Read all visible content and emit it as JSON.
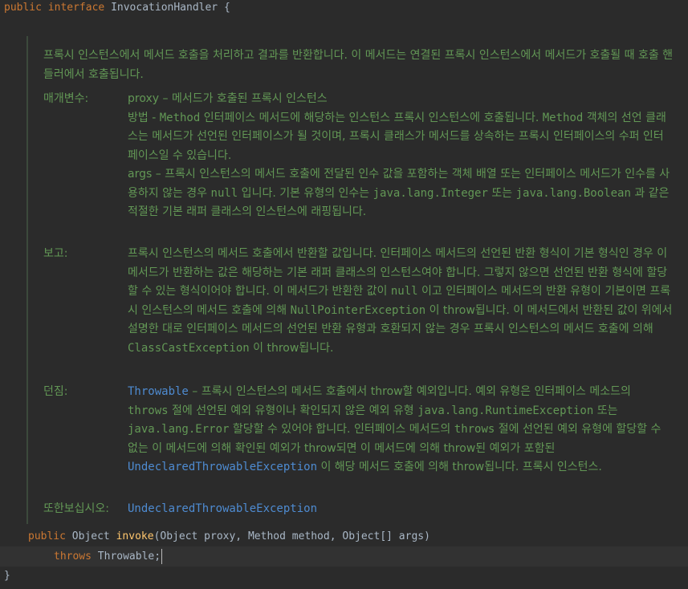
{
  "code": {
    "line1": {
      "kw1": "public",
      "kw2": "interface",
      "name": "InvocationHandler",
      "brace": " {"
    },
    "method": {
      "kw": "public",
      "ret": " Object ",
      "name": "invoke",
      "params": "(Object proxy, Method method, Object[] args)"
    },
    "throws": {
      "kw": "throws",
      "rest": " Throwable;"
    },
    "close": "}"
  },
  "doc": {
    "intro": "프록시 인스턴스에서 메서드 호출을 처리하고 결과를 반환합니다. 이 메서드는 연결된 프록시 인스턴스에서 메서드가 호출될 때 호출 핸들러에서 호출됩니다.",
    "params_label": "매개변수:",
    "proxy_p1": "proxy – 메서드가 호출된 프록시 인스턴스",
    "method_a": "방법 - ",
    "method_b": "Method",
    "method_c": " 인터페이스 메서드에 해당하는 인스턴스 프록시 인스턴스에 호출됩니다. ",
    "method_d": "Method",
    "method_e": " 객체의 선언 클래스는 메서드가 선언된 인터페이스가 될 것이며, 프록시 클래스가 메서드를 상속하는 프록시 인터페이스의 수퍼 인터페이스일 수 있습니다.",
    "args_a": "args – 프록시 인스턴스의 메서드 호출에 전달된 인수 값을 포함하는 객체 배열 또는 인터페이스 메서드가 인수를 사용하지 않는 경우 ",
    "args_b": "null",
    "args_c": " 입니다. 기본 유형의 인수는 ",
    "args_d": "java.lang.Integer",
    "args_e": " 또는 ",
    "args_f": "java.lang.Boolean",
    "args_g": " 과 같은 적절한 기본 래퍼 클래스의 인스턴스에 래핑됩니다.",
    "returns_label": "보고:",
    "ret_a": "프록시 인스턴스의 메서드 호출에서 반환할 값입니다. 인터페이스 메서드의 선언된 반환 형식이 기본 형식인 경우 이 메서드가 반환하는 값은 해당하는 기본 래퍼 클래스의 인스턴스여야 합니다. 그렇지 않으면 선언된 반환 형식에 할당할 수 있는 형식이어야 합니다. 이 메서드가 반환한 값이 ",
    "ret_b": "null",
    "ret_c": " 이고 인터페이스 메서드의 반환 유형이 기본이면 프록시 인스턴스의 메서드 호출에 의해 ",
    "ret_d": "NullPointerException",
    "ret_e": " 이 throw됩니다. 이 메서드에서 반환된 값이 위에서 설명한 대로 인터페이스 메서드의 선언된 반환 유형과 호환되지 않는 경우 프록시 인스턴스의 메서드 호출에 의해 ",
    "ret_f": "ClassCastException",
    "ret_g": " 이 throw됩니다.",
    "throws_label": "던짐:",
    "thr_a": "Throwable",
    "thr_b": " – 프록시 인스턴스의 메서드 호출에서 throw할 예외입니다. 예외 유형은 인터페이스 메소드의 ",
    "thr_c": "throws",
    "thr_d": " 절에 선언된 예외 유형이나 확인되지 않은 예외 유형 ",
    "thr_e": "java.lang.RuntimeException",
    "thr_f": " 또는 ",
    "thr_g": "java.lang.Error",
    "thr_h": " 할당할 수 있어야 합니다. 인터페이스 메서드의 ",
    "thr_i": "throws",
    "thr_j": " 절에 선언된 예외 유형에 할당할 수 없는 이 메서드에 의해 확인된 예외가 throw되면 이 메서드에 의해 throw된 예외가 포함된 ",
    "thr_k": "UndeclaredThrowableException",
    "thr_l": " 이 해당 메서드 호출에 의해 throw됩니다. 프록시 인스턴스.",
    "see_label": "또한보십시오:",
    "see_link": "UndeclaredThrowableException"
  }
}
